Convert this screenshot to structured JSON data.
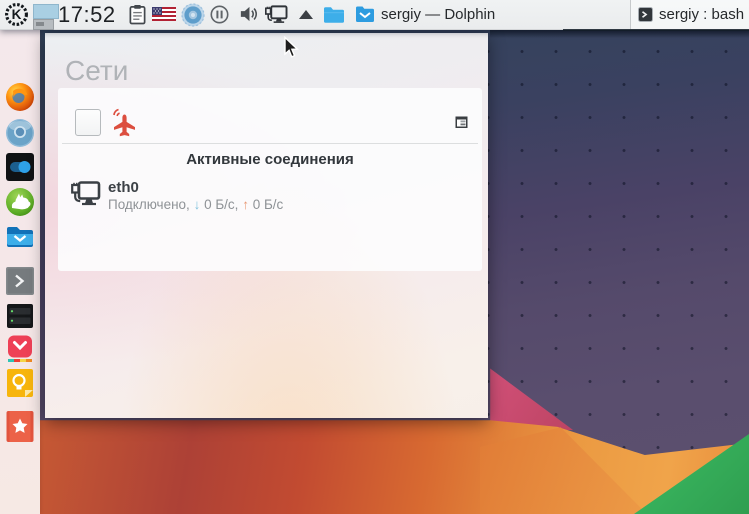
{
  "panel": {
    "clock": "17:52",
    "dolphin_task": "sergiy — Dolphin",
    "bash_task": "sergiy : bash"
  },
  "popup": {
    "title": "Сети",
    "active_header": "Активные соединения",
    "connection": {
      "name": "eth0",
      "status_prefix": "Подключено, ",
      "down_arrow": "↓",
      "down_rate": " 0 Б/с, ",
      "up_arrow": "↑",
      "up_rate": " 0 Б/с"
    }
  },
  "colors": {
    "accent_blue": "#3daee9",
    "down_arrow": "#7fc0dc",
    "up_arrow": "#e89a77",
    "airplane_red": "#dc4e3f",
    "wallpaper_purple": "#554a6b",
    "wallpaper_orange": "#e88c3c",
    "wallpaper_green": "#36b55e"
  }
}
